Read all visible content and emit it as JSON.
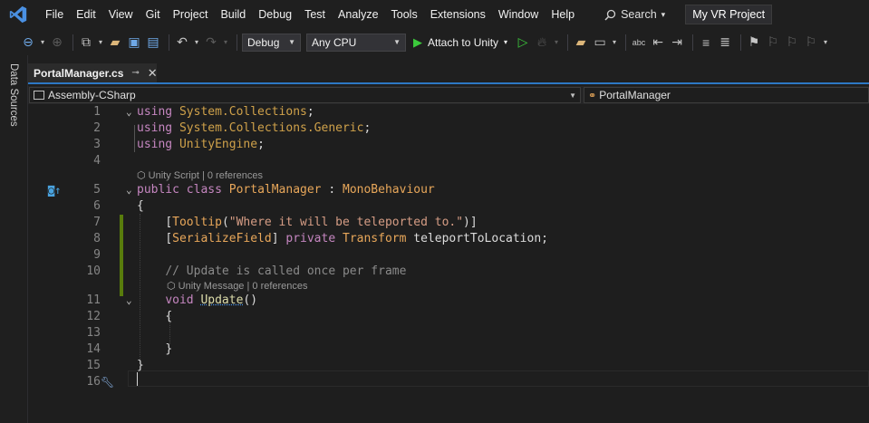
{
  "menubar": {
    "items": [
      "File",
      "Edit",
      "View",
      "Git",
      "Project",
      "Build",
      "Debug",
      "Test",
      "Analyze",
      "Tools",
      "Extensions",
      "Window",
      "Help"
    ],
    "search_label": "Search",
    "project_name": "My VR Project"
  },
  "toolbar": {
    "configuration": "Debug",
    "platform": "Any CPU",
    "attach_label": "Attach to Unity"
  },
  "side_panel": {
    "label": "Data Sources"
  },
  "tab": {
    "name": "PortalManager.cs"
  },
  "navbar": {
    "project": "Assembly-CSharp",
    "member": "PortalManager"
  },
  "lens": {
    "class_lens": "Unity Script | 0 references",
    "method_lens": "Unity Message | 0 references"
  },
  "code": {
    "l1_kw": "using",
    "l1_ns": "System.Collections",
    "l1_end": ";",
    "l2_kw": "using",
    "l2_ns": "System.Collections.Generic",
    "l2_end": ";",
    "l3_kw": "using",
    "l3_ns": "UnityEngine",
    "l3_end": ";",
    "l5_kw1": "public",
    "l5_kw2": "class",
    "l5_name": "PortalManager",
    "l5_colon": " : ",
    "l5_base": "MonoBehaviour",
    "l6": "{",
    "l7_open": "[",
    "l7_attr": "Tooltip",
    "l7_paren": "(",
    "l7_str": "\"Where it will be teleported to.\"",
    "l7_close": ")]",
    "l8_open": "[",
    "l8_attr": "SerializeField",
    "l8_close": "]",
    "l8_kw": "private",
    "l8_type": "Transform",
    "l8_field": "teleportToLocation",
    "l8_end": ";",
    "l10": "// Update is called once per frame",
    "l11_kw": "void",
    "l11_name": "Update",
    "l11_parens": "()",
    "l12": "{",
    "l14": "}",
    "l15": "}"
  },
  "line_numbers": [
    "1",
    "2",
    "3",
    "4",
    "5",
    "6",
    "7",
    "8",
    "9",
    "10",
    "11",
    "12",
    "13",
    "14",
    "15",
    "16"
  ]
}
